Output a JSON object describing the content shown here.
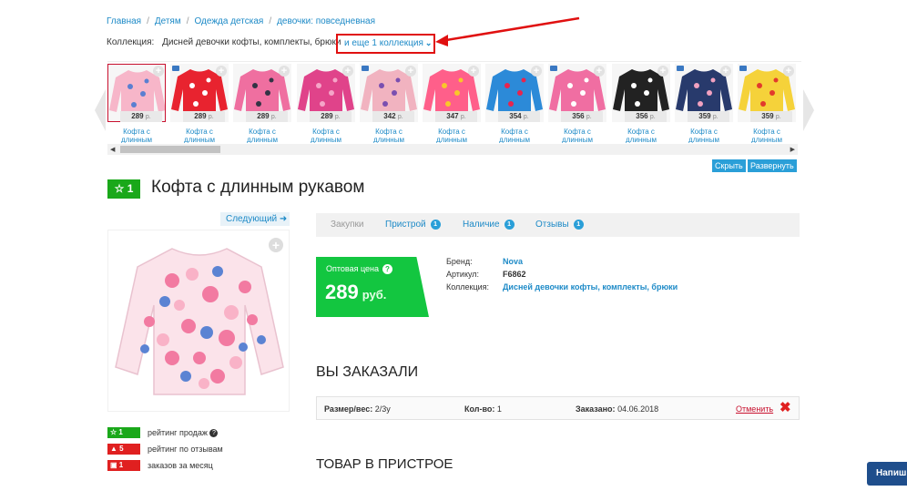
{
  "breadcrumb": [
    "Главная",
    "Детям",
    "Одежда детская",
    "девочки: повседневная"
  ],
  "collection": {
    "label": "Коллекция:",
    "name": "Дисней девочки кофты, комплекты, брюки",
    "more": "и еще 1 коллекция"
  },
  "carousel": {
    "items": [
      {
        "price": "289",
        "currency": "р.",
        "caption": "Кофта с длинным",
        "colors": [
          "#f7b6c9",
          "#5a7fd1"
        ],
        "active": true
      },
      {
        "price": "289",
        "currency": "р.",
        "caption": "Кофта с длинным",
        "colors": [
          "#e8232f",
          "#ffffff"
        ],
        "active": false
      },
      {
        "price": "289",
        "currency": "р.",
        "caption": "Кофта с длинным",
        "colors": [
          "#ef6fa0",
          "#333344"
        ],
        "active": false
      },
      {
        "price": "289",
        "currency": "р.",
        "caption": "Кофта с длинным",
        "colors": [
          "#e0438a",
          "#f5a5c8"
        ],
        "active": false
      },
      {
        "price": "342",
        "currency": "р.",
        "caption": "Кофта с длинным",
        "colors": [
          "#f1b3c0",
          "#7a4fb0"
        ],
        "active": false
      },
      {
        "price": "347",
        "currency": "р.",
        "caption": "Кофта с длинным",
        "colors": [
          "#ff5f8a",
          "#f9c62a"
        ],
        "active": false
      },
      {
        "price": "354",
        "currency": "р.",
        "caption": "Кофта с длинным",
        "colors": [
          "#2c8ad8",
          "#e8244d"
        ],
        "active": false
      },
      {
        "price": "356",
        "currency": "р.",
        "caption": "Кофта с длинным",
        "colors": [
          "#f06ea2",
          "#ffffff"
        ],
        "active": false
      },
      {
        "price": "356",
        "currency": "р.",
        "caption": "Кофта с длинным",
        "colors": [
          "#222222",
          "#ffffff"
        ],
        "active": false
      },
      {
        "price": "359",
        "currency": "р.",
        "caption": "Кофта с длинным",
        "colors": [
          "#283a6c",
          "#f2a1c0"
        ],
        "active": false
      },
      {
        "price": "359",
        "currency": "р.",
        "caption": "Кофта с длинным",
        "colors": [
          "#f5d23a",
          "#e23a2c"
        ],
        "active": false
      }
    ],
    "hide_label": "Скрыть",
    "expand_label": "Развернуть"
  },
  "product": {
    "badge": "1",
    "title": "Кофта с длинным рукавом",
    "next_label": "Следующий"
  },
  "tabs": [
    {
      "label": "Закупки",
      "count": null,
      "muted": true
    },
    {
      "label": "Пристрой",
      "count": "1"
    },
    {
      "label": "Наличие",
      "count": "1"
    },
    {
      "label": "Отзывы",
      "count": "1"
    }
  ],
  "price": {
    "label": "Оптовая цена",
    "value": "289",
    "currency": "руб."
  },
  "meta": {
    "brand_label": "Бренд:",
    "brand": "Nova",
    "article_label": "Артикул:",
    "article": "F6862",
    "collection_label": "Коллекция:",
    "collection": "Дисней девочки кофты, комплекты, брюки"
  },
  "stats": [
    {
      "value": "1",
      "label": "рейтинг продаж",
      "color": "#1aa81a",
      "icon": "star-icon"
    },
    {
      "value": "5",
      "label": "рейтинг по отзывам",
      "color": "#e02020",
      "icon": "thumbs-up-icon"
    },
    {
      "value": "1",
      "label": "заказов за месяц",
      "color": "#e02020",
      "icon": "basket-icon"
    }
  ],
  "ordered": {
    "heading": "ВЫ ЗАКАЗАЛИ",
    "size_label": "Размер/вес:",
    "size": "2/3y",
    "qty_label": "Кол-во:",
    "qty": "1",
    "date_label": "Заказано:",
    "date": "04.06.2018",
    "cancel": "Отменить"
  },
  "pristroy_heading": "ТОВАР В ПРИСТРОЕ",
  "chat_button": "Напиш"
}
